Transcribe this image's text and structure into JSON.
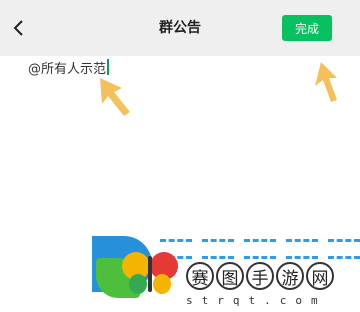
{
  "header": {
    "title": "群公告",
    "done_label": "完成"
  },
  "editor": {
    "text": "@所有人示范"
  },
  "colors": {
    "accent": "#07c160",
    "arrow": "#f5c05a",
    "navbar": "#efefef"
  },
  "icons": {
    "back": "chevron-left-icon",
    "pointer": "arrow-up-left-icon"
  },
  "watermark": {
    "characters": [
      "赛",
      "图",
      "手",
      "游",
      "网"
    ],
    "domain": "strqt.com"
  }
}
